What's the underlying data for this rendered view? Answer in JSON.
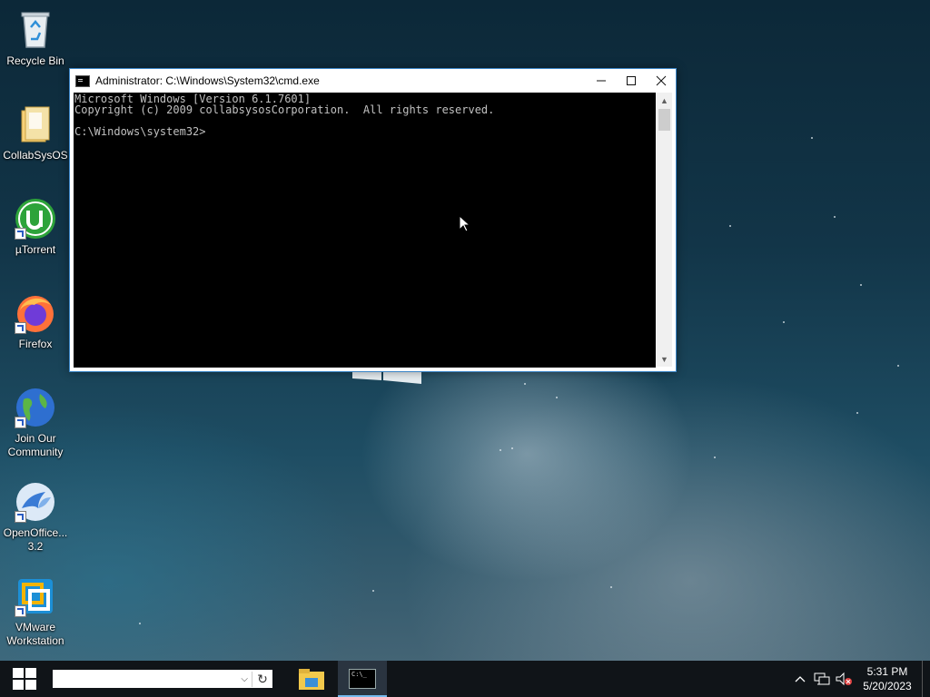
{
  "desktop": {
    "icons": [
      {
        "label": "Recycle Bin"
      },
      {
        "label": "CollabSysOS"
      },
      {
        "label": "µTorrent"
      },
      {
        "label": "Firefox"
      },
      {
        "label": "Join Our Community"
      },
      {
        "label": "OpenOffice... 3.2"
      },
      {
        "label": "VMware Workstation"
      }
    ]
  },
  "cmd_window": {
    "title": "Administrator: C:\\Windows\\System32\\cmd.exe",
    "console_text": "Microsoft Windows [Version 6.1.7601]\nCopyright (c) 2009 collabsysosCorporation.  All rights reserved.\n\nC:\\Windows\\system32>"
  },
  "taskbar": {
    "search_value": "",
    "cmd_app_label": "C:\\_",
    "clock_time": "5:31 PM",
    "clock_date": "5/20/2023"
  },
  "icons": {
    "start": "windows-logo-icon",
    "search_dropdown": "chevron-down-icon",
    "search_refresh": "refresh-icon",
    "file_explorer": "folder-icon",
    "cmd": "cmd-icon",
    "tray_chevron": "chevron-up-icon",
    "network": "network-icon",
    "volume": "volume-muted-icon"
  },
  "colors": {
    "accent": "#3c86c8",
    "taskbar": "#101418",
    "console_bg": "#000000",
    "console_fg": "#c0c0c0"
  }
}
